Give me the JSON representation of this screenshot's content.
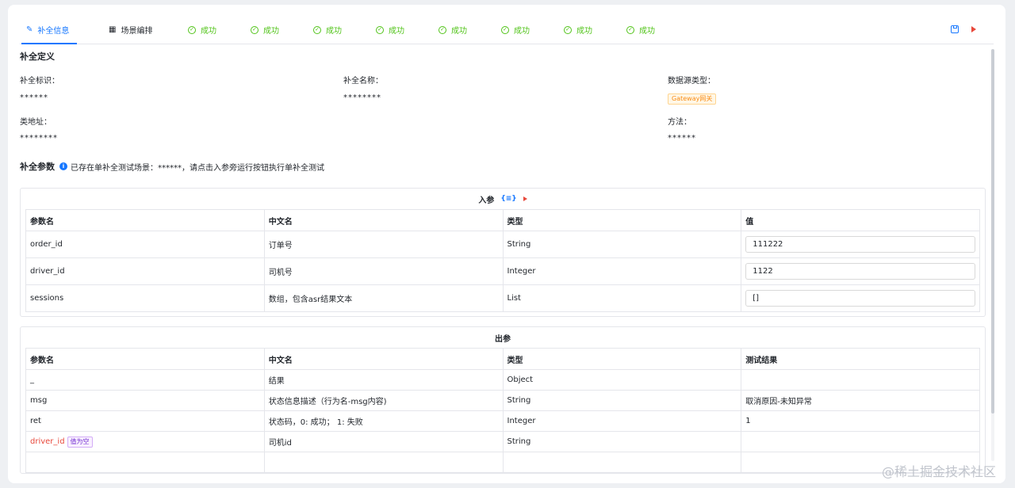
{
  "tabs": [
    {
      "label": "补全信息",
      "state": "active",
      "icon": "pen-icon"
    },
    {
      "label": "场景编排",
      "state": "normal",
      "icon": "grid-icon"
    },
    {
      "label": "成功",
      "state": "success"
    },
    {
      "label": "成功",
      "state": "success"
    },
    {
      "label": "成功",
      "state": "success"
    },
    {
      "label": "成功",
      "state": "success"
    },
    {
      "label": "成功",
      "state": "success"
    },
    {
      "label": "成功",
      "state": "success"
    },
    {
      "label": "成功",
      "state": "success"
    },
    {
      "label": "成功",
      "state": "success"
    }
  ],
  "definition": {
    "title": "补全定义",
    "id_label": "补全标识：",
    "id_value": "******",
    "name_label": "补全名称：",
    "name_value": "********",
    "source_label": "数据源类型：",
    "source_tag": "Gateway网关",
    "class_label": "类地址：",
    "class_value": "********",
    "method_label": "方法：",
    "method_value": "******"
  },
  "params": {
    "title": "补全参数",
    "note": "已存在单补全测试场景：******，请点击入参旁运行按钮执行单补全测试"
  },
  "input_table": {
    "caption": "入参",
    "headers": [
      "参数名",
      "中文名",
      "类型",
      "值"
    ],
    "rows": [
      {
        "name": "order_id",
        "cn": "订单号",
        "type": "String",
        "value": "111222"
      },
      {
        "name": "driver_id",
        "cn": "司机号",
        "type": "Integer",
        "value": "1122"
      },
      {
        "name": "sessions",
        "cn": "数组，包含asr结果文本",
        "type": "List",
        "value": "[]"
      }
    ]
  },
  "output_table": {
    "caption": "出参",
    "headers": [
      "参数名",
      "中文名",
      "类型",
      "测试结果"
    ],
    "rows": [
      {
        "name": "_",
        "cn": "结果",
        "type": "Object",
        "result": ""
      },
      {
        "name": "msg",
        "cn": "状态信息描述（行为名-msg内容)",
        "type": "String",
        "result": "取消原因-未知异常"
      },
      {
        "name": "ret",
        "cn": "状态码，0: 成功； 1: 失败",
        "type": "Integer",
        "result": "1"
      },
      {
        "name": "driver_id",
        "cn": "司机id",
        "type": "String",
        "result": "",
        "tag": "值为空"
      }
    ]
  },
  "watermark": "@稀土掘金技术社区",
  "colors": {
    "primary": "#1677ff",
    "success": "#52c41a",
    "danger": "#e8483b",
    "warning": "#fa8c16"
  }
}
